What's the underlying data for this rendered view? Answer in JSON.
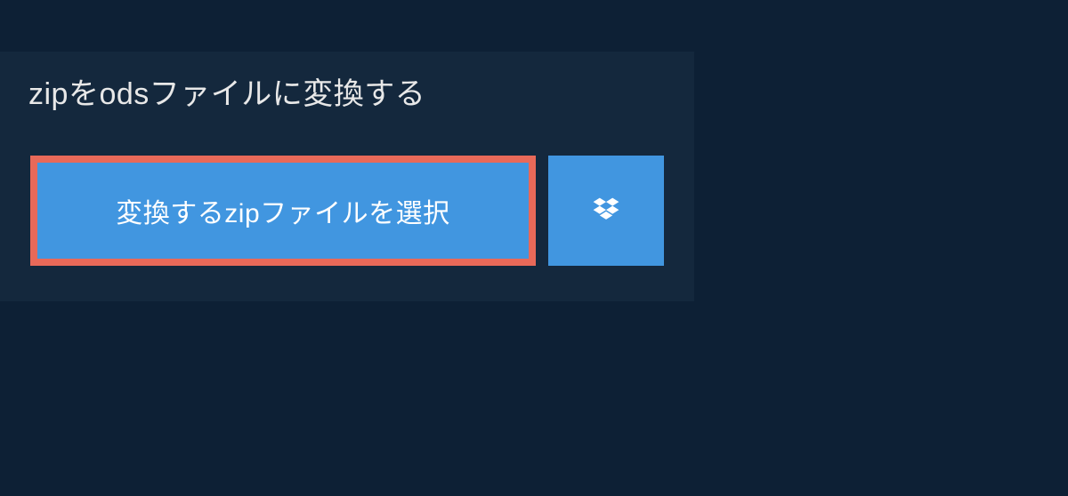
{
  "panel": {
    "title": "zipをodsファイルに変換する",
    "select_button_label": "変換するzipファイルを選択"
  },
  "colors": {
    "page_bg": "#0d2035",
    "panel_bg": "#14283d",
    "button_bg": "#4196e0",
    "button_border": "#e86959",
    "text_light": "#e8e8e8",
    "text_white": "#ffffff"
  }
}
